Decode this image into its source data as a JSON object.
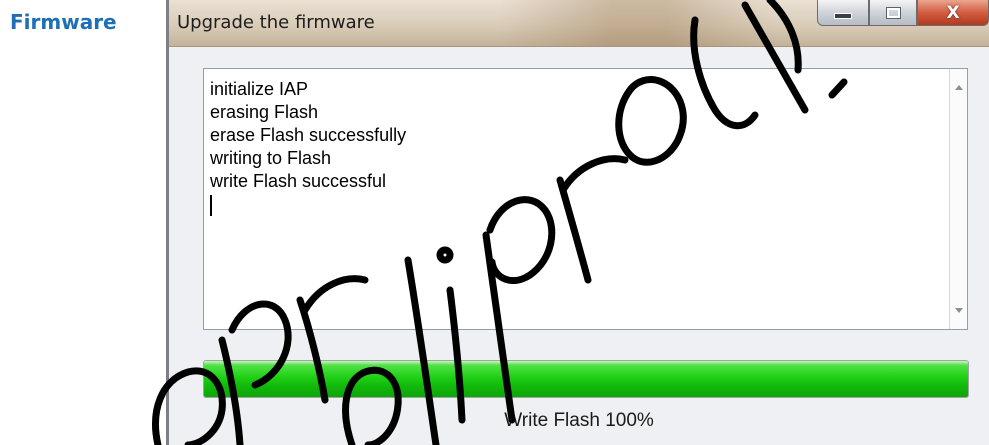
{
  "section_label": "Firmware",
  "colors": {
    "section_label": "#1f6fb6",
    "progress_green": "#1fd015",
    "close_button": "#c9492c"
  },
  "window": {
    "title": "Upgrade the firmware",
    "buttons": {
      "minimize_icon": "minimize-icon",
      "maximize_icon": "maximize-icon",
      "close_glyph": "X"
    }
  },
  "log": {
    "lines": [
      "initialize IAP",
      "erasing Flash",
      "erase Flash successfully",
      "writing to Flash",
      "write Flash successful"
    ]
  },
  "progress": {
    "percent": 100,
    "label": "Write Flash  100%"
  }
}
